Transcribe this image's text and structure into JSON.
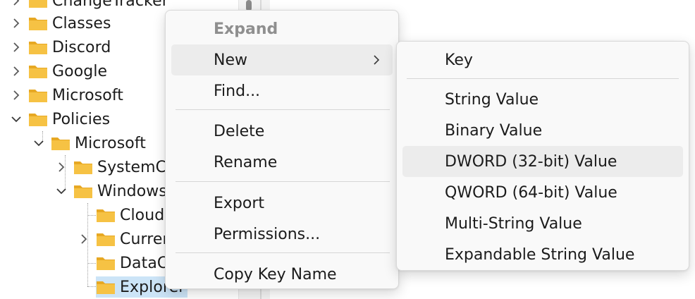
{
  "tree": {
    "items": [
      {
        "label": "ChangeTracker",
        "expander": "collapsed"
      },
      {
        "label": "Classes",
        "expander": "collapsed"
      },
      {
        "label": "Discord",
        "expander": "collapsed"
      },
      {
        "label": "Google",
        "expander": "collapsed"
      },
      {
        "label": "Microsoft",
        "expander": "collapsed"
      },
      {
        "label": "Policies",
        "expander": "expanded"
      },
      {
        "label": "Microsoft",
        "expander": "expanded"
      },
      {
        "label": "SystemCertificates",
        "expander": "collapsed"
      },
      {
        "label": "Windows",
        "expander": "expanded"
      },
      {
        "label": "CloudContent",
        "expander": "none"
      },
      {
        "label": "CurrentVersion",
        "expander": "collapsed"
      },
      {
        "label": "DataCollection",
        "expander": "none"
      },
      {
        "label": "Explorer",
        "expander": "none",
        "selected": true
      }
    ]
  },
  "context_menu": {
    "expand": "Expand",
    "new": "New",
    "find": "Find...",
    "delete": "Delete",
    "rename": "Rename",
    "export": "Export",
    "permissions": "Permissions...",
    "copy_key_name": "Copy Key Name"
  },
  "new_submenu": {
    "key": "Key",
    "string_value": "String Value",
    "binary_value": "Binary Value",
    "dword_value": "DWORD (32-bit) Value",
    "qword_value": "QWORD (64-bit) Value",
    "multi_string_value": "Multi-String Value",
    "expandable_string_value": "Expandable String Value"
  },
  "colors": {
    "folder_fill": "#f6c244",
    "folder_tab": "#e7a823",
    "selection": "#cce4f7",
    "menu_hover": "#ececec",
    "menu_bg": "#f9f9f9"
  }
}
